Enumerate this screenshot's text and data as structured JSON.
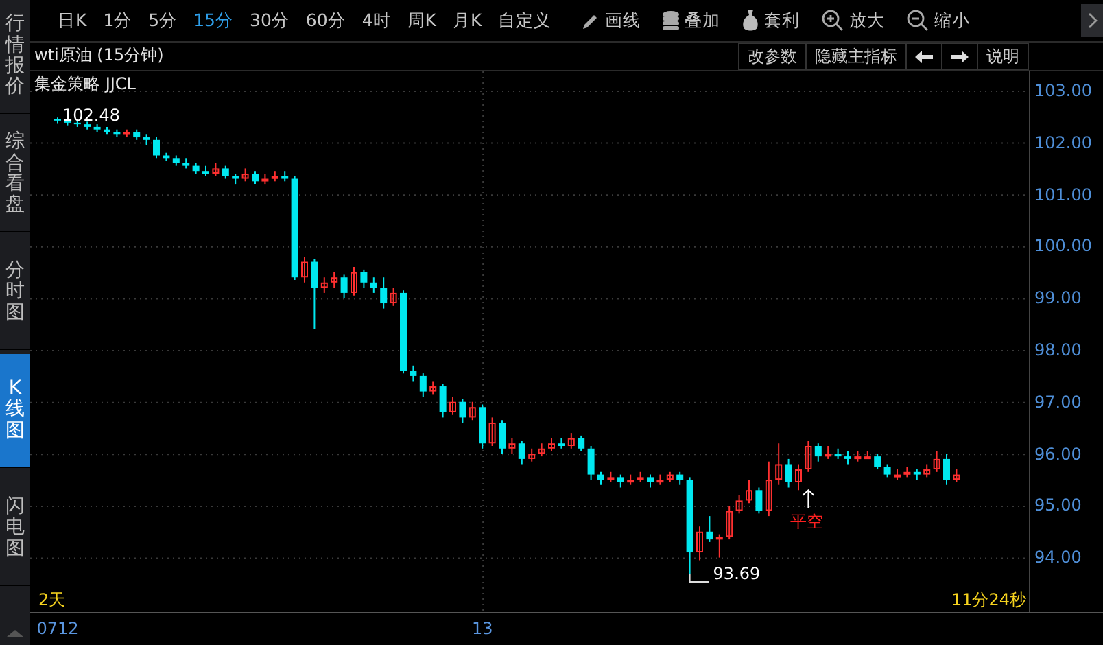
{
  "sidebar": {
    "items": [
      {
        "label": "行情报价",
        "selected": false
      },
      {
        "label": "综合看盘",
        "selected": false
      },
      {
        "label": "分时图",
        "selected": false
      },
      {
        "label": "K线图",
        "selected": true
      },
      {
        "label": "闪电图",
        "selected": false
      }
    ]
  },
  "toolbar": {
    "periods": [
      {
        "label": "日K",
        "selected": false
      },
      {
        "label": "1分",
        "selected": false
      },
      {
        "label": "5分",
        "selected": false
      },
      {
        "label": "15分",
        "selected": true
      },
      {
        "label": "30分",
        "selected": false
      },
      {
        "label": "60分",
        "selected": false
      },
      {
        "label": "4时",
        "selected": false
      },
      {
        "label": "周K",
        "selected": false
      },
      {
        "label": "月K",
        "selected": false
      },
      {
        "label": "自定义",
        "selected": false
      }
    ],
    "tools": [
      {
        "label": "画线",
        "kind": "pencil"
      },
      {
        "label": "叠加",
        "kind": "coins"
      },
      {
        "label": "套利",
        "kind": "bag"
      },
      {
        "label": "放大",
        "kind": "zoom-in"
      },
      {
        "label": "缩小",
        "kind": "zoom-out"
      }
    ]
  },
  "chart_header": {
    "title": "wti原油 (15分钟)",
    "buttons": [
      {
        "kind": "text",
        "label": "改参数"
      },
      {
        "kind": "text",
        "label": "隐藏主指标"
      },
      {
        "kind": "left"
      },
      {
        "kind": "right"
      },
      {
        "kind": "text",
        "label": "说明"
      }
    ]
  },
  "chart": {
    "strategy": "集金策略 JJCL",
    "high_label": "102.48",
    "low_label": "93.69",
    "signal": "平空",
    "range_label": "2天",
    "countdown": "11分24秒",
    "chart_data": {
      "type": "candlestick",
      "grid": true,
      "ylim": [
        92.95,
        103.37
      ],
      "yticks": [
        {
          "value": 103,
          "label": "103.00"
        },
        {
          "value": 102,
          "label": "102.00"
        },
        {
          "value": 101,
          "label": "101.00"
        },
        {
          "value": 100,
          "label": "100.00"
        },
        {
          "value": 99,
          "label": "99.00"
        },
        {
          "value": 98,
          "label": "98.00"
        },
        {
          "value": 97,
          "label": "97.00"
        },
        {
          "value": 96,
          "label": "96.00"
        },
        {
          "value": 95,
          "label": "95.00"
        },
        {
          "value": 94,
          "label": "94.00"
        }
      ],
      "categories": [
        "0712",
        null,
        null,
        null,
        null,
        null,
        null,
        null,
        null,
        null,
        null,
        null,
        null,
        null,
        null,
        null,
        null,
        null,
        null,
        null,
        null,
        null,
        null,
        null,
        null,
        null,
        null,
        null,
        null,
        null,
        null,
        null,
        null,
        null,
        null,
        null,
        null,
        null,
        null,
        null,
        null,
        null,
        null,
        "13",
        null,
        null,
        null,
        null,
        null,
        null,
        null,
        null,
        null,
        null,
        null,
        null,
        null,
        null,
        null,
        null,
        null,
        null,
        null,
        null,
        null,
        null,
        null,
        null,
        null,
        null,
        null,
        null,
        null,
        null,
        null,
        null,
        null,
        null,
        null,
        null,
        null,
        null,
        null,
        null,
        null,
        null,
        null,
        null,
        null,
        null,
        null,
        null
      ],
      "ohlc": [
        [
          102.45,
          102.48,
          102.37,
          102.42
        ],
        [
          102.42,
          102.47,
          102.33,
          102.38
        ],
        [
          102.38,
          102.43,
          102.3,
          102.35
        ],
        [
          102.35,
          102.4,
          102.25,
          102.3
        ],
        [
          102.3,
          102.35,
          102.2,
          102.25
        ],
        [
          102.25,
          102.3,
          102.15,
          102.2
        ],
        [
          102.2,
          102.25,
          102.1,
          102.15
        ],
        [
          102.15,
          102.25,
          102.1,
          102.2
        ],
        [
          102.2,
          102.25,
          102.05,
          102.1
        ],
        [
          102.1,
          102.15,
          101.95,
          102.05
        ],
        [
          102.05,
          102.1,
          101.7,
          101.75
        ],
        [
          101.75,
          101.8,
          101.65,
          101.7
        ],
        [
          101.7,
          101.75,
          101.55,
          101.6
        ],
        [
          101.6,
          101.7,
          101.5,
          101.55
        ],
        [
          101.55,
          101.6,
          101.4,
          101.45
        ],
        [
          101.45,
          101.55,
          101.35,
          101.4
        ],
        [
          101.4,
          101.6,
          101.35,
          101.5
        ],
        [
          101.5,
          101.55,
          101.3,
          101.35
        ],
        [
          101.35,
          101.4,
          101.2,
          101.3
        ],
        [
          101.3,
          101.5,
          101.25,
          101.4
        ],
        [
          101.4,
          101.45,
          101.2,
          101.25
        ],
        [
          101.25,
          101.4,
          101.2,
          101.3
        ],
        [
          101.3,
          101.45,
          101.25,
          101.35
        ],
        [
          101.35,
          101.45,
          101.25,
          101.3
        ],
        [
          101.3,
          101.35,
          99.35,
          99.4
        ],
        [
          99.4,
          99.8,
          99.3,
          99.7
        ],
        [
          99.7,
          99.75,
          98.4,
          99.2
        ],
        [
          99.2,
          99.4,
          99.1,
          99.3
        ],
        [
          99.3,
          99.5,
          99.2,
          99.4
        ],
        [
          99.4,
          99.45,
          99.0,
          99.1
        ],
        [
          99.1,
          99.6,
          99.05,
          99.5
        ],
        [
          99.5,
          99.55,
          99.2,
          99.3
        ],
        [
          99.3,
          99.4,
          99.1,
          99.2
        ],
        [
          99.2,
          99.4,
          98.8,
          98.9
        ],
        [
          98.9,
          99.2,
          98.85,
          99.1
        ],
        [
          99.1,
          99.15,
          97.55,
          97.6
        ],
        [
          97.6,
          97.7,
          97.4,
          97.5
        ],
        [
          97.5,
          97.55,
          97.1,
          97.2
        ],
        [
          97.2,
          97.4,
          97.15,
          97.3
        ],
        [
          97.3,
          97.35,
          96.7,
          96.8
        ],
        [
          96.8,
          97.1,
          96.75,
          97.0
        ],
        [
          97.0,
          97.05,
          96.6,
          96.7
        ],
        [
          96.7,
          97.0,
          96.65,
          96.9
        ],
        [
          96.9,
          96.95,
          96.1,
          96.2
        ],
        [
          96.2,
          96.7,
          96.15,
          96.6
        ],
        [
          96.6,
          96.65,
          96.0,
          96.1
        ],
        [
          96.1,
          96.3,
          96.0,
          96.2
        ],
        [
          96.2,
          96.25,
          95.8,
          95.9
        ],
        [
          95.9,
          96.1,
          95.85,
          96.0
        ],
        [
          96.0,
          96.2,
          95.95,
          96.1
        ],
        [
          96.1,
          96.3,
          96.05,
          96.2
        ],
        [
          96.2,
          96.3,
          96.1,
          96.15
        ],
        [
          96.15,
          96.4,
          96.1,
          96.3
        ],
        [
          96.3,
          96.35,
          96.05,
          96.1
        ],
        [
          96.1,
          96.15,
          95.5,
          95.6
        ],
        [
          95.6,
          95.65,
          95.4,
          95.5
        ],
        [
          95.5,
          95.65,
          95.45,
          95.55
        ],
        [
          95.55,
          95.6,
          95.35,
          95.45
        ],
        [
          95.45,
          95.6,
          95.4,
          95.5
        ],
        [
          95.5,
          95.65,
          95.45,
          95.55
        ],
        [
          95.55,
          95.6,
          95.35,
          95.45
        ],
        [
          95.45,
          95.6,
          95.4,
          95.5
        ],
        [
          95.5,
          95.65,
          95.45,
          95.6
        ],
        [
          95.6,
          95.65,
          95.4,
          95.5
        ],
        [
          95.5,
          95.55,
          93.69,
          94.1
        ],
        [
          94.1,
          94.6,
          93.95,
          94.5
        ],
        [
          94.5,
          94.8,
          94.3,
          94.35
        ],
        [
          94.35,
          94.45,
          94.0,
          94.4
        ],
        [
          94.4,
          95.0,
          94.35,
          94.9
        ],
        [
          94.9,
          95.2,
          94.85,
          95.1
        ],
        [
          95.1,
          95.5,
          95.05,
          95.3
        ],
        [
          95.3,
          95.35,
          94.85,
          94.9
        ],
        [
          94.9,
          95.85,
          94.8,
          95.5
        ],
        [
          95.5,
          96.2,
          95.4,
          95.8
        ],
        [
          95.8,
          95.9,
          95.35,
          95.45
        ],
        [
          95.45,
          95.8,
          95.3,
          95.7
        ],
        [
          95.7,
          96.25,
          95.65,
          96.15
        ],
        [
          96.15,
          96.2,
          95.85,
          95.95
        ],
        [
          95.95,
          96.15,
          95.9,
          96.0
        ],
        [
          96.0,
          96.1,
          95.9,
          95.95
        ],
        [
          95.95,
          96.05,
          95.8,
          95.9
        ],
        [
          95.9,
          96.05,
          95.85,
          95.95
        ],
        [
          95.95,
          96.05,
          95.9,
          95.95
        ],
        [
          95.95,
          96.0,
          95.7,
          95.75
        ],
        [
          95.75,
          95.8,
          95.55,
          95.6
        ],
        [
          95.6,
          95.7,
          95.5,
          95.6
        ],
        [
          95.6,
          95.75,
          95.55,
          95.65
        ],
        [
          95.65,
          95.7,
          95.5,
          95.6
        ],
        [
          95.6,
          95.8,
          95.55,
          95.7
        ],
        [
          95.7,
          96.05,
          95.65,
          95.9
        ],
        [
          95.9,
          96.0,
          95.4,
          95.5
        ],
        [
          95.5,
          95.7,
          95.45,
          95.6
        ]
      ]
    }
  }
}
